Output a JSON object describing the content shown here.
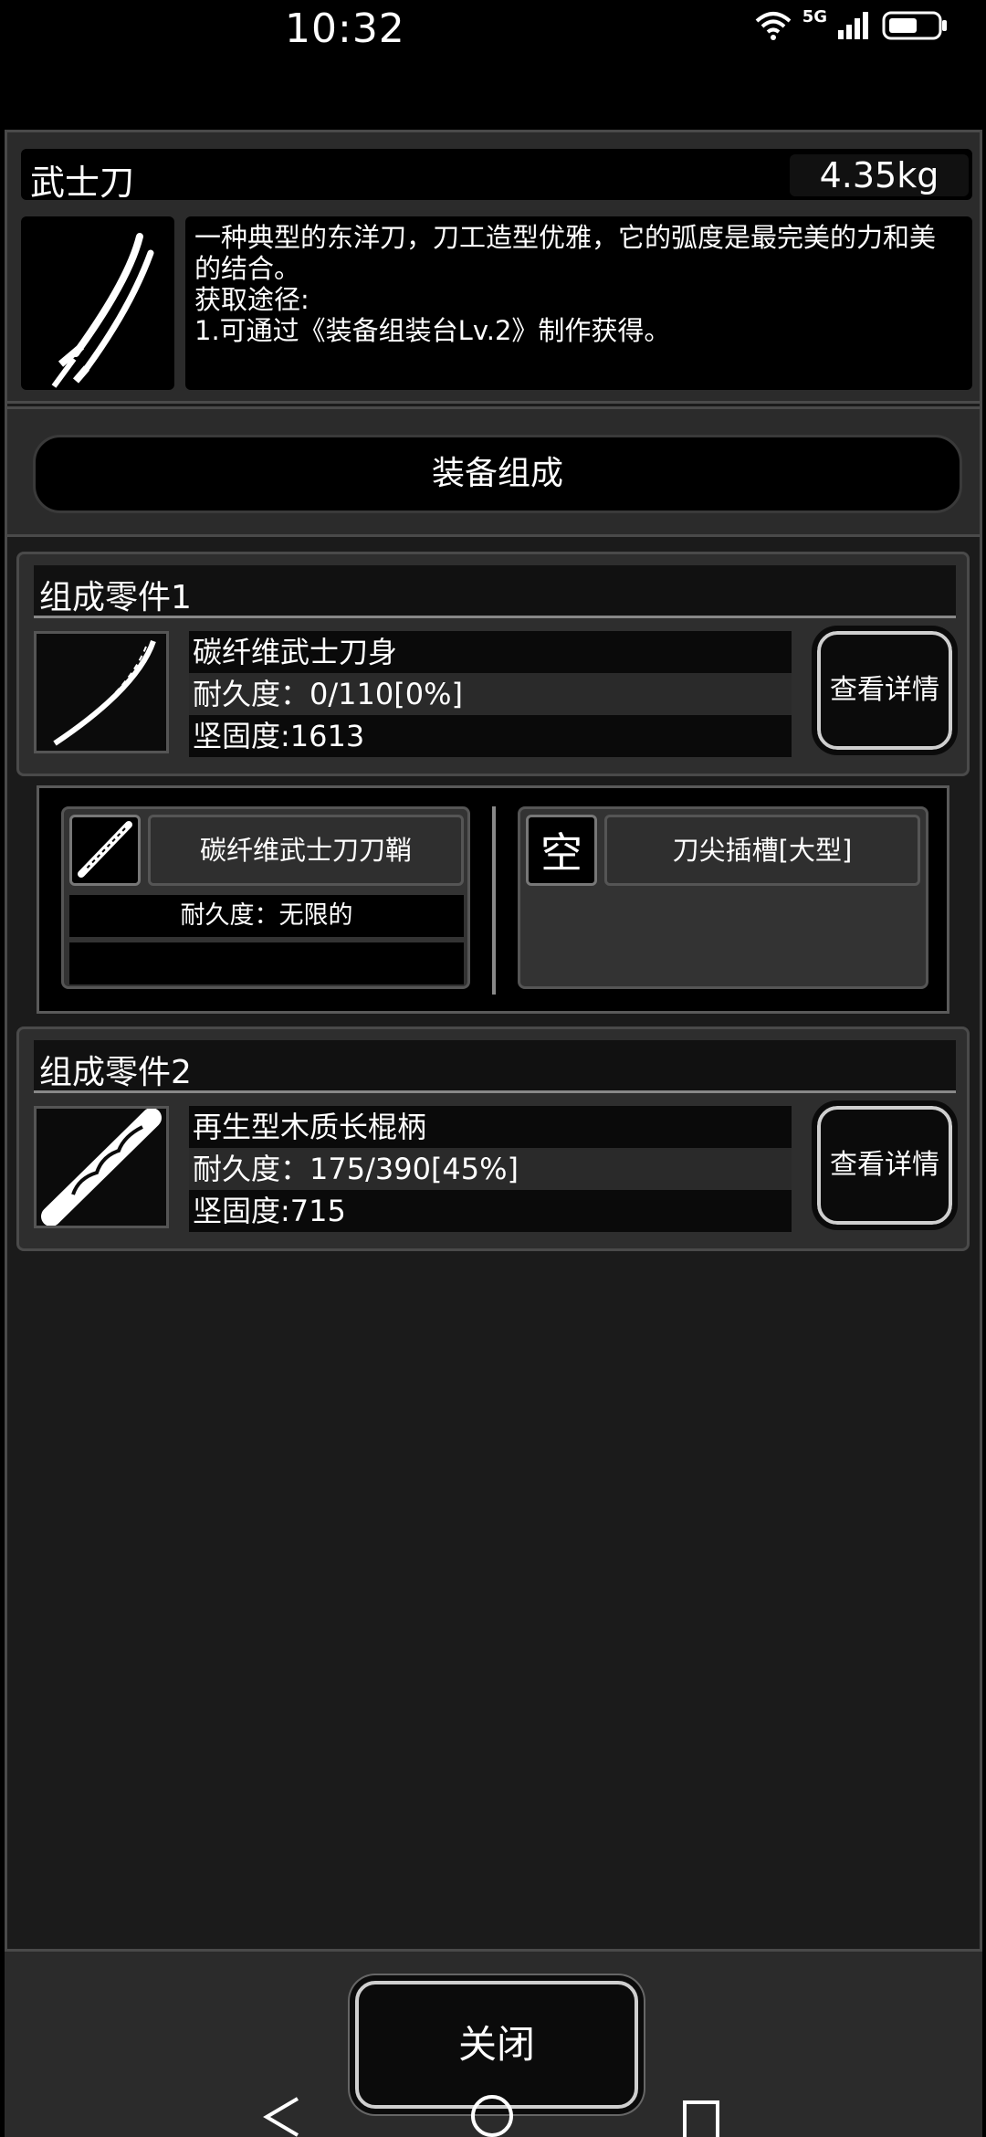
{
  "status": {
    "time": "10:32",
    "network": "5G"
  },
  "item": {
    "name": "武士刀",
    "weight": "4.35kg",
    "description_line1": "一种典型的东洋刀，刀工造型优雅，它的弧度是最完美的力和美",
    "description_line2": "的结合。",
    "source_label": "获取途径:",
    "source_detail": "1.可通过《装备组装台Lv.2》制作获得。"
  },
  "composition_button": "装备组成",
  "parts": [
    {
      "header": "组成零件1",
      "name": "碳纤维武士刀身",
      "durability": "耐久度：0/110[0%]",
      "hardness": "坚固度:1613",
      "detail_button": "查看详情"
    },
    {
      "header": "组成零件2",
      "name": "再生型木质长棍柄",
      "durability": "耐久度：175/390[45%]",
      "hardness": "坚固度:715",
      "detail_button": "查看详情"
    }
  ],
  "sub_slots": {
    "left": {
      "name": "碳纤维武士刀刀鞘",
      "durability": "耐久度：无限的"
    },
    "right": {
      "icon_text": "空",
      "name": "刀尖插槽[大型]"
    }
  },
  "close_button": "关闭"
}
